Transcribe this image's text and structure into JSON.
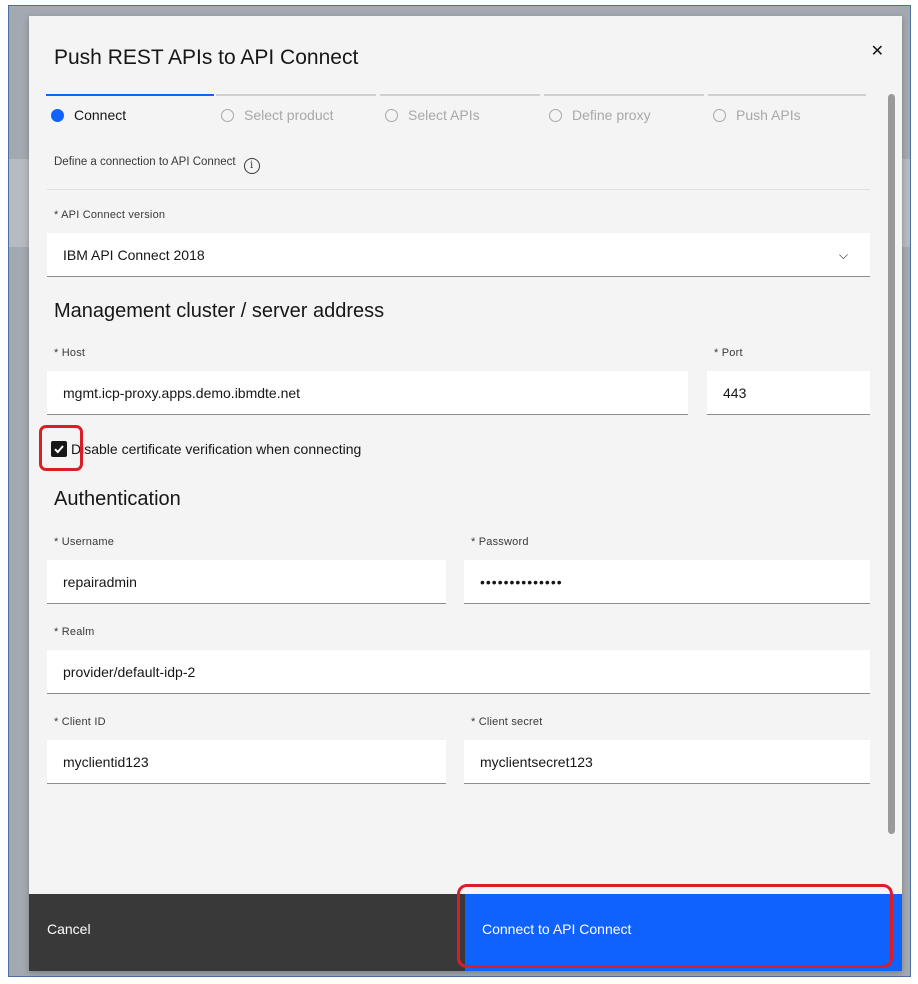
{
  "modal": {
    "title": "Push REST APIs to API Connect"
  },
  "steps": [
    {
      "label": "Connect",
      "active": true
    },
    {
      "label": "Select product",
      "active": false
    },
    {
      "label": "Select APIs",
      "active": false
    },
    {
      "label": "Define proxy",
      "active": false
    },
    {
      "label": "Push APIs",
      "active": false
    }
  ],
  "description": "Define a connection to API Connect",
  "version": {
    "label": "* API Connect version",
    "value": "IBM API Connect 2018"
  },
  "management": {
    "heading": "Management cluster / server address",
    "host_label": "* Host",
    "host_value": "mgmt.icp-proxy.apps.demo.ibmdte.net",
    "port_label": "* Port",
    "port_value": "443"
  },
  "certificate": {
    "label": "Disable certificate verification when connecting",
    "checked": true
  },
  "authentication": {
    "heading": "Authentication",
    "username_label": "* Username",
    "username_value": "repairadmin",
    "password_label": "* Password",
    "password_value": "••••••••••••••",
    "realm_label": "* Realm",
    "realm_value": "provider/default-idp-2",
    "client_id_label": "* Client ID",
    "client_id_value": "myclientid123",
    "client_secret_label": "* Client secret",
    "client_secret_value": "myclientsecret123"
  },
  "footer": {
    "cancel_label": "Cancel",
    "connect_label": "Connect to API Connect"
  },
  "colors": {
    "accent": "#0f62fe",
    "highlight": "#da1e28",
    "secondary_button": "#393939"
  },
  "icons": {
    "close": "close-icon",
    "info": "info-icon",
    "chevron": "chevron-down-icon",
    "checkmark": "checkmark-icon"
  }
}
